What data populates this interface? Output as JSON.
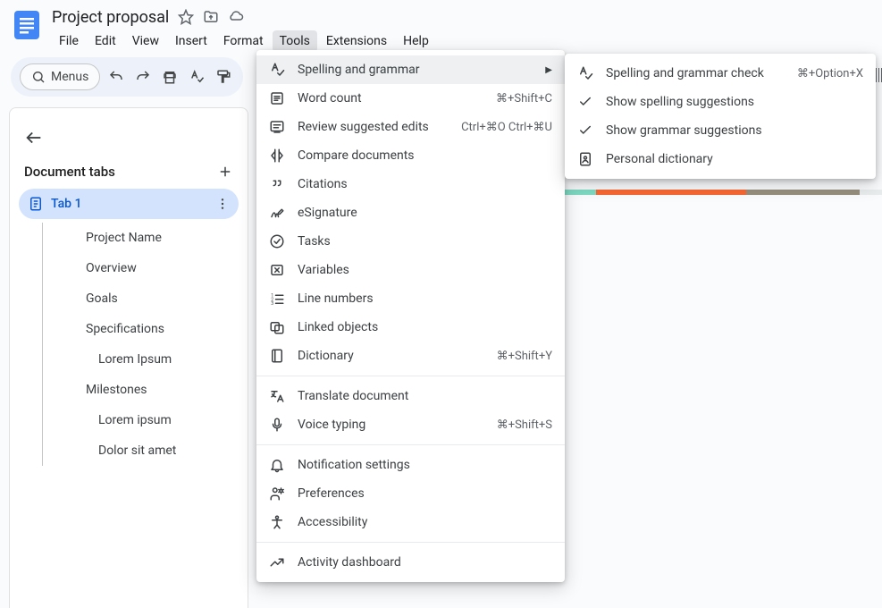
{
  "header": {
    "doc_title": "Project proposal",
    "menubar": [
      "File",
      "Edit",
      "View",
      "Insert",
      "Format",
      "Tools",
      "Extensions",
      "Help"
    ],
    "active_menu_index": 5
  },
  "toolbar": {
    "menus_label": "Menus"
  },
  "left_panel": {
    "title": "Document tabs",
    "tab_label": "Tab 1",
    "outline": [
      {
        "label": "Project Name",
        "level": 1
      },
      {
        "label": "Overview",
        "level": 1
      },
      {
        "label": "Goals",
        "level": 1
      },
      {
        "label": "Specifications",
        "level": 1
      },
      {
        "label": "Lorem Ipsum",
        "level": 2
      },
      {
        "label": "Milestones",
        "level": 1
      },
      {
        "label": "Lorem ipsum",
        "level": 2
      },
      {
        "label": "Dolor sit amet",
        "level": 2
      }
    ]
  },
  "tools_menu": [
    {
      "icon": "spellcheck",
      "label": "Spelling and grammar",
      "submenu": true,
      "highlight": true
    },
    {
      "icon": "wordcount",
      "label": "Word count",
      "shortcut": "⌘+Shift+C"
    },
    {
      "icon": "review",
      "label": "Review suggested edits",
      "shortcut": "Ctrl+⌘O Ctrl+⌘U"
    },
    {
      "icon": "compare",
      "label": "Compare documents"
    },
    {
      "icon": "citations",
      "label": "Citations"
    },
    {
      "icon": "esign",
      "label": "eSignature"
    },
    {
      "icon": "tasks",
      "label": "Tasks"
    },
    {
      "icon": "variables",
      "label": "Variables"
    },
    {
      "icon": "linenum",
      "label": "Line numbers"
    },
    {
      "icon": "linked",
      "label": "Linked objects"
    },
    {
      "icon": "dictionary",
      "label": "Dictionary",
      "shortcut": "⌘+Shift+Y"
    },
    {
      "sep": true
    },
    {
      "icon": "translate",
      "label": "Translate document"
    },
    {
      "icon": "voice",
      "label": "Voice typing",
      "shortcut": "⌘+Shift+S"
    },
    {
      "sep": true
    },
    {
      "icon": "notif",
      "label": "Notification settings"
    },
    {
      "icon": "prefs",
      "label": "Preferences"
    },
    {
      "icon": "access",
      "label": "Accessibility"
    },
    {
      "sep": true
    },
    {
      "icon": "activity",
      "label": "Activity dashboard"
    }
  ],
  "spelling_submenu": [
    {
      "icon": "spellcheck",
      "label": "Spelling and grammar check",
      "shortcut": "⌘+Option+X"
    },
    {
      "icon": "check",
      "label": "Show spelling suggestions"
    },
    {
      "icon": "check",
      "label": "Show grammar suggestions"
    },
    {
      "icon": "dictpersonal",
      "label": "Personal dictionary"
    }
  ]
}
